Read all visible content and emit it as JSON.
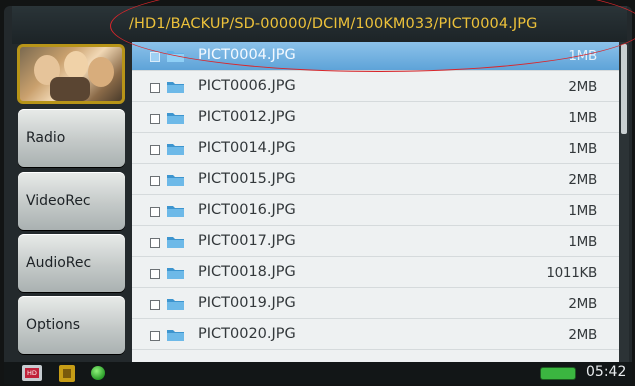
{
  "path": "/HD1/BACKUP/SD-00000/DCIM/100KM033/PICT0004.JPG",
  "sidebar": {
    "thumbnail_icon": "photo-thumbnail",
    "buttons": [
      {
        "label": "Radio"
      },
      {
        "label": "VideoRec"
      },
      {
        "label": "AudioRec"
      },
      {
        "label": "Options"
      }
    ]
  },
  "files": [
    {
      "name": "PICT0004.JPG",
      "size": "1MB",
      "selected": true
    },
    {
      "name": "PICT0006.JPG",
      "size": "2MB"
    },
    {
      "name": "PICT0012.JPG",
      "size": "1MB"
    },
    {
      "name": "PICT0014.JPG",
      "size": "1MB"
    },
    {
      "name": "PICT0015.JPG",
      "size": "2MB"
    },
    {
      "name": "PICT0016.JPG",
      "size": "1MB"
    },
    {
      "name": "PICT0017.JPG",
      "size": "1MB"
    },
    {
      "name": "PICT0018.JPG",
      "size": "1011KB"
    },
    {
      "name": "PICT0019.JPG",
      "size": "2MB"
    },
    {
      "name": "PICT0020.JPG",
      "size": "2MB"
    }
  ],
  "statusbar": {
    "hd_icon_label": "HD",
    "clock": "05:42",
    "battery_icon": "battery-full-icon"
  },
  "colors": {
    "path_text": "#ecc13a",
    "selection": "#6aaadc",
    "annotation": "#d9262b"
  }
}
